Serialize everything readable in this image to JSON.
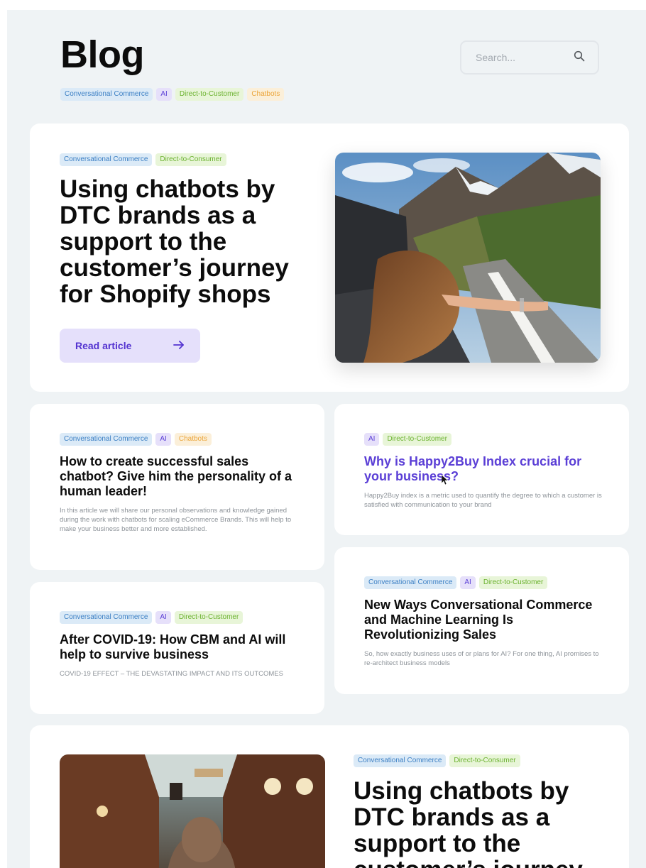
{
  "header": {
    "title": "Blog",
    "search_placeholder": "Search..."
  },
  "filter_tags": [
    "Conversational Commerce",
    "AI",
    "Direct-to-Customer",
    "Chatbots"
  ],
  "featured": {
    "tags": [
      "Conversational Commerce",
      "Direct-to-Consumer"
    ],
    "title": "Using chatbots by DTC brands as a support to the customer’s journey for Shopify shops",
    "button_label": "Read article"
  },
  "articles": [
    {
      "tags": [
        "Conversational Commerce",
        "AI",
        "Chatbots"
      ],
      "title": "How to create successful sales chatbot? Give him the personality of a human leader!",
      "excerpt": "In this article we will share our personal observations and knowledge gained during the work with chatbots for scaling eCommerce Brands. This will help to make your business better and more established."
    },
    {
      "tags": [
        "AI",
        "Direct-to-Customer"
      ],
      "title": "Why is Happy2Buy Index crucial for your business?",
      "excerpt": "Happy2Buy index is a metric used to quantify the degree to which a customer is satisfied with communication to your brand"
    },
    {
      "tags": [
        "Conversational Commerce",
        "AI",
        "Direct-to-Customer"
      ],
      "title": "After COVID-19: How CBM and AI will help to survive business",
      "excerpt": "COVID-19 EFFECT – THE DEVASTATING IMPACT AND ITS OUTCOMES"
    },
    {
      "tags": [
        "Conversational Commerce",
        "AI",
        "Direct-to-Customer"
      ],
      "title": "New Ways Conversational Commerce and Machine Learning Is Revolutionizing Sales",
      "excerpt": "So, how exactly business uses of or plans for AI? For one thing, AI promises to re-architect business models"
    }
  ],
  "featured_bottom": {
    "tags": [
      "Conversational Commerce",
      "Direct-to-Consumer"
    ],
    "title": "Using chatbots by DTC brands as a support to the customer’s journey"
  },
  "colors": {
    "accent": "#5b3fd6",
    "background": "#eff3f5",
    "tag_conversational": "#3b7fc4",
    "tag_ai": "#5b3fd6",
    "tag_direct": "#6bb22f",
    "tag_chatbots": "#eba53a"
  },
  "icons": {
    "search": "search-icon",
    "arrow": "arrow-right-icon"
  }
}
